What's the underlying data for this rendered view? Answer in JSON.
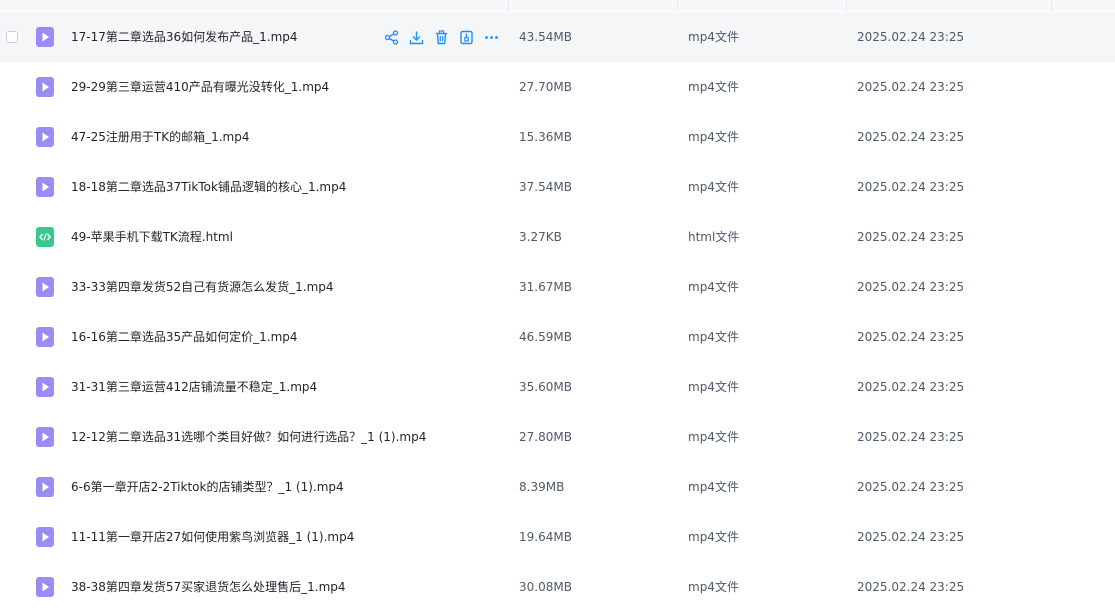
{
  "files": [
    {
      "name": "17-17第二章选品36如何发布产品_1.mp4",
      "size": "43.54MB",
      "type": "mp4文件",
      "date": "2025.02.24 23:25",
      "icon": "video-file-icon",
      "hovered": true
    },
    {
      "name": "29-29第三章运营410产品有曝光没转化_1.mp4",
      "size": "27.70MB",
      "type": "mp4文件",
      "date": "2025.02.24 23:25",
      "icon": "video-file-icon"
    },
    {
      "name": "47-25注册用于TK的邮箱_1.mp4",
      "size": "15.36MB",
      "type": "mp4文件",
      "date": "2025.02.24 23:25",
      "icon": "video-file-icon"
    },
    {
      "name": "18-18第二章选品37TikTok铺品逻辑的核心_1.mp4",
      "size": "37.54MB",
      "type": "mp4文件",
      "date": "2025.02.24 23:25",
      "icon": "video-file-icon"
    },
    {
      "name": "49-苹果手机下载TK流程.html",
      "size": "3.27KB",
      "type": "html文件",
      "date": "2025.02.24 23:25",
      "icon": "html-file-icon"
    },
    {
      "name": "33-33第四章发货52自己有货源怎么发货_1.mp4",
      "size": "31.67MB",
      "type": "mp4文件",
      "date": "2025.02.24 23:25",
      "icon": "video-file-icon"
    },
    {
      "name": "16-16第二章选品35产品如何定价_1.mp4",
      "size": "46.59MB",
      "type": "mp4文件",
      "date": "2025.02.24 23:25",
      "icon": "video-file-icon"
    },
    {
      "name": "31-31第三章运营412店铺流量不稳定_1.mp4",
      "size": "35.60MB",
      "type": "mp4文件",
      "date": "2025.02.24 23:25",
      "icon": "video-file-icon"
    },
    {
      "name": "12-12第二章选品31选哪个类目好做？如何进行选品？_1 (1).mp4",
      "size": "27.80MB",
      "type": "mp4文件",
      "date": "2025.02.24 23:25",
      "icon": "video-file-icon"
    },
    {
      "name": "6-6第一章开店2-2Tiktok的店铺类型？_1 (1).mp4",
      "size": "8.39MB",
      "type": "mp4文件",
      "date": "2025.02.24 23:25",
      "icon": "video-file-icon"
    },
    {
      "name": "11-11第一章开店27如何使用紫鸟浏览器_1 (1).mp4",
      "size": "19.64MB",
      "type": "mp4文件",
      "date": "2025.02.24 23:25",
      "icon": "video-file-icon"
    },
    {
      "name": "38-38第四章发货57买家退货怎么处理售后_1.mp4",
      "size": "30.08MB",
      "type": "mp4文件",
      "date": "2025.02.24 23:25",
      "icon": "video-file-icon"
    }
  ],
  "row_actions": [
    "share-icon",
    "download-icon",
    "delete-icon",
    "extract-icon",
    "more-icon"
  ],
  "colors": {
    "accent": "#1890ff",
    "video_icon": "#9a8cf5",
    "html_icon": "#36c98e",
    "hover_row": "#f5f6f8"
  }
}
